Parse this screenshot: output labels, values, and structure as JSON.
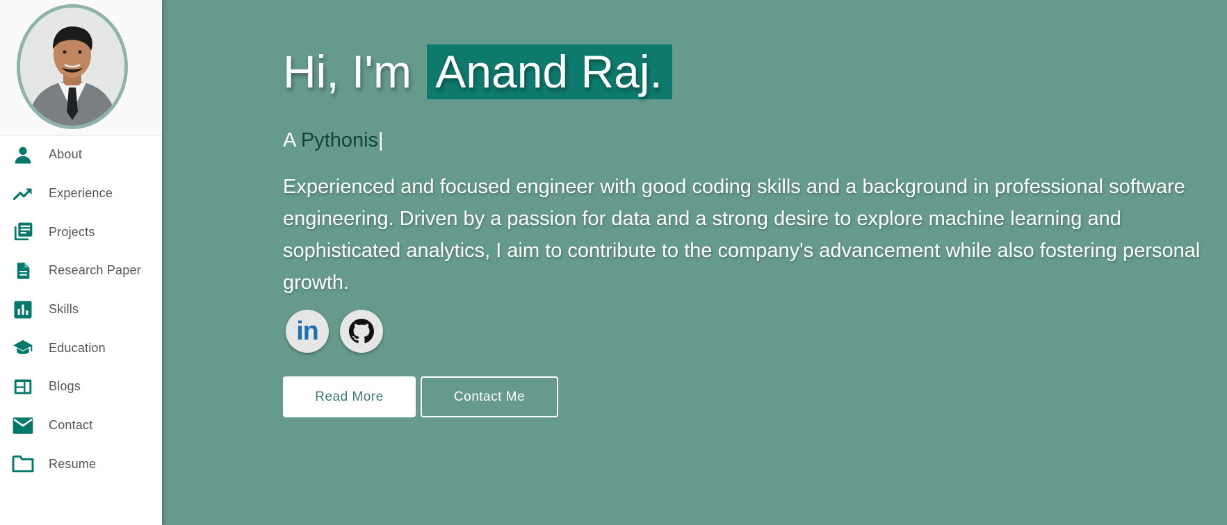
{
  "sidebar": {
    "items": [
      {
        "label": "About",
        "icon": "person-icon"
      },
      {
        "label": "Experience",
        "icon": "trending-up-icon"
      },
      {
        "label": "Projects",
        "icon": "library-books-icon"
      },
      {
        "label": "Research Paper",
        "icon": "document-icon"
      },
      {
        "label": "Skills",
        "icon": "bar-chart-icon"
      },
      {
        "label": "Education",
        "icon": "graduation-cap-icon"
      },
      {
        "label": "Blogs",
        "icon": "web-layout-icon"
      },
      {
        "label": "Contact",
        "icon": "mail-icon"
      },
      {
        "label": "Resume",
        "icon": "folder-icon"
      }
    ]
  },
  "hero": {
    "greeting": "Hi, I'm",
    "name": "Anand Raj.",
    "tagline_prefix": "A",
    "tagline_role": "Pythonis",
    "tagline_cursor": "|",
    "bio": "Experienced and focused engineer with good coding skills and a background in professional software engineering. Driven by a passion for data and a strong desire to explore machine learning and sophisticated analytics, I aim to contribute to the company's advancement while also fostering personal growth."
  },
  "social": {
    "linkedin_text": "in",
    "linkedin_icon": "linkedin-icon",
    "github_icon": "github-icon"
  },
  "buttons": {
    "read_more": "Read More",
    "contact_me": "Contact Me"
  },
  "colors": {
    "accent": "#00796b",
    "background": "#659a8c",
    "name_highlight": "#0e7a6e",
    "linkedin_blue": "#1f6fb2"
  }
}
